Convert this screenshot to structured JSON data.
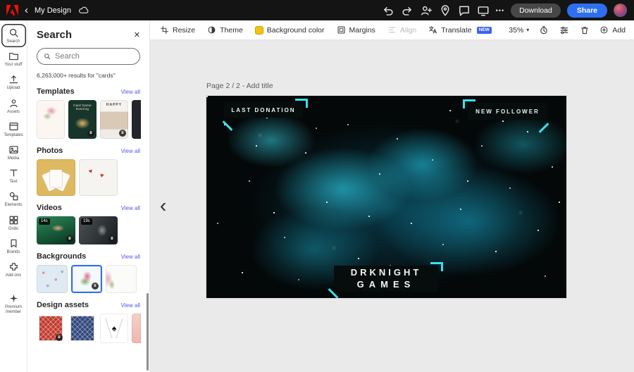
{
  "topbar": {
    "title": "My Design",
    "download_label": "Download",
    "share_label": "Share"
  },
  "icons": {
    "back": "‹",
    "more": "•••",
    "close": "✕",
    "caret_down": "▾",
    "page_prev": "‹",
    "premium_crown": "♛",
    "heart": "♥",
    "spade": "♠"
  },
  "rail": {
    "items": [
      {
        "label": "Search",
        "icon": "search-icon"
      },
      {
        "label": "Your stuff",
        "icon": "folder-icon"
      },
      {
        "label": "Upload",
        "icon": "upload-icon"
      },
      {
        "label": "Assets",
        "icon": "person-icon"
      },
      {
        "label": "Templates",
        "icon": "templates-icon"
      },
      {
        "label": "Media",
        "icon": "media-icon"
      },
      {
        "label": "Text",
        "icon": "text-icon"
      },
      {
        "label": "Elements",
        "icon": "shapes-icon"
      },
      {
        "label": "Grids",
        "icon": "grid-icon"
      },
      {
        "label": "Brands",
        "icon": "bookmark-icon"
      },
      {
        "label": "Add-ons",
        "icon": "puzzle-icon"
      },
      {
        "label": "Premium member",
        "icon": "star-icon"
      }
    ]
  },
  "search_panel": {
    "title": "Search",
    "input_placeholder": "Search",
    "results_text": "6,263,000+ results for \"cards\"",
    "sections": [
      {
        "title": "Templates",
        "view_all": "View all"
      },
      {
        "title": "Photos",
        "view_all": "View all"
      },
      {
        "title": "Videos",
        "view_all": "View all"
      },
      {
        "title": "Backgrounds",
        "view_all": "View all"
      },
      {
        "title": "Design assets",
        "view_all": "View all"
      }
    ],
    "template_thumb_labels": [
      "",
      "Card Game Evening",
      "HAPPY",
      ""
    ],
    "videos": {
      "durations": [
        "14s",
        "19s"
      ]
    }
  },
  "toolbar": {
    "resize_label": "Resize",
    "theme_label": "Theme",
    "background_color_label": "Background color",
    "margins_label": "Margins",
    "align_label": "Align",
    "translate_label": "Translate",
    "new_badge": "NEW",
    "zoom_value": "35%",
    "add_label": "Add"
  },
  "canvas": {
    "page_label": "Page 2 / 2 - Add title",
    "overlays": {
      "last_donation": "LAST DONATION",
      "new_follower": "NEW FOLLOWER",
      "title_line1": "DRKNIGHT",
      "title_line2": "GAMES"
    }
  },
  "colors": {
    "topbar_black": "#141414",
    "share_button_blue": "#2e6ff2",
    "new_badge_blue": "#3b63f3",
    "view_all_blue": "#5258e4",
    "selected_thumb_border": "#2e6ff2",
    "background_swatch_yellow": "#f2c40f",
    "overlay_accent_cyan": "#38e1ee",
    "adobe_red": "#fa0f00"
  }
}
